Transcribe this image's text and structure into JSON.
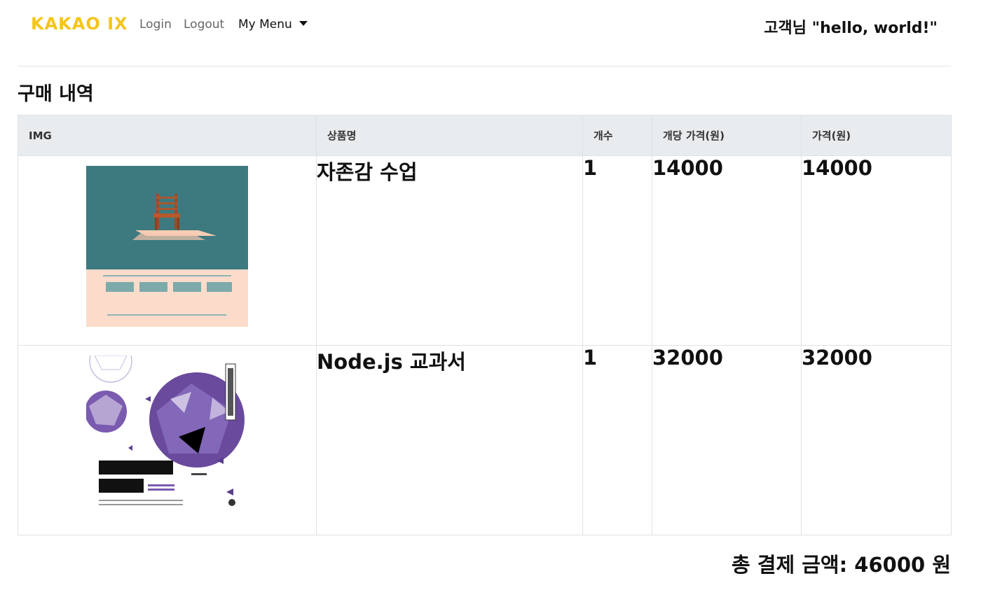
{
  "nav": {
    "brand": "KAKAO IX",
    "login": "Login",
    "logout": "Logout",
    "my_menu": "My Menu",
    "greeting": "고객님 \"hello, world!\""
  },
  "page": {
    "title": "구매 내역"
  },
  "table": {
    "headers": [
      "IMG",
      "상품명",
      "개수",
      "개당 가격(원)",
      "가격(원)"
    ],
    "rows": [
      {
        "image": "book-cover-self-esteem",
        "name": "자존감 수업",
        "quantity": "1",
        "unit_price": "14000",
        "price": "14000"
      },
      {
        "image": "book-cover-nodejs",
        "name": "Node.js 교과서",
        "quantity": "1",
        "unit_price": "32000",
        "price": "32000"
      }
    ]
  },
  "total": {
    "label": "총 결제 금액:",
    "amount": "46000",
    "unit": "원"
  },
  "colors": {
    "brand": "#f5c518",
    "header_bg": "#e9ecef",
    "book1_top": "#3d7a7f",
    "book1_bottom": "#fbdccb",
    "book2_accent": "#6a4a9c"
  }
}
